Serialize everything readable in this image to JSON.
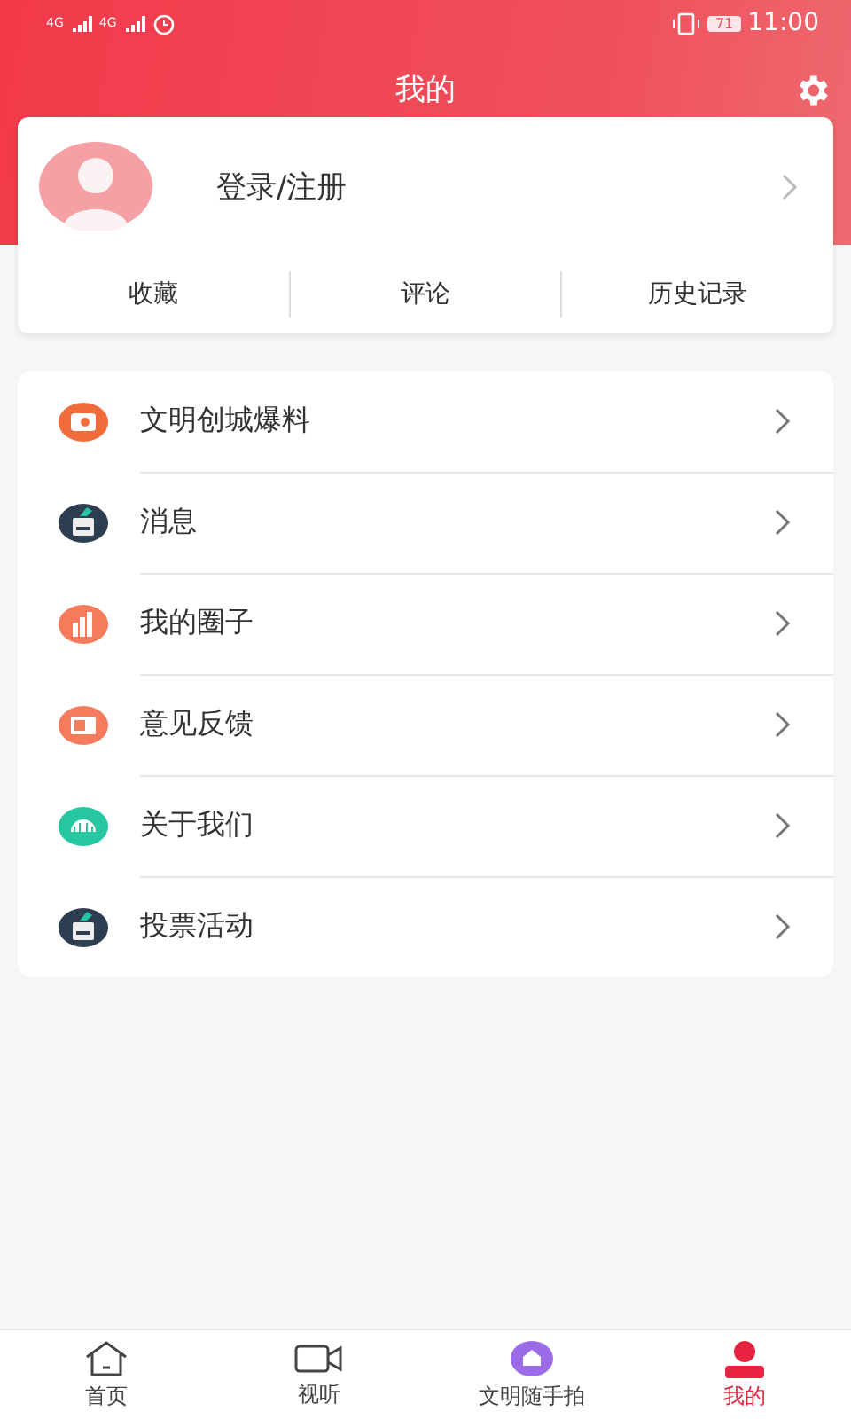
{
  "status_bar": {
    "network": [
      "4G",
      "4G"
    ],
    "battery": "71",
    "time": "11:00"
  },
  "header": {
    "title": "我的"
  },
  "profile": {
    "login": "登录/注册",
    "links": [
      "收藏",
      "评论",
      "历史记录"
    ]
  },
  "menu": [
    {
      "label": "文明创城爆料",
      "kind": "camera",
      "color": "#f26b3a"
    },
    {
      "label": "消息",
      "kind": "ballot",
      "color": "#2c3e50"
    },
    {
      "label": "我的圈子",
      "kind": "chart",
      "color": "#f47b5c"
    },
    {
      "label": "意见反馈",
      "kind": "screen",
      "color": "#f47b5c"
    },
    {
      "label": "关于我们",
      "kind": "globe",
      "color": "#26c6a0"
    },
    {
      "label": "投票活动",
      "kind": "ballot",
      "color": "#2c3e50"
    }
  ],
  "tab_bar": [
    {
      "label": "首页",
      "kind": "home",
      "selected": false
    },
    {
      "label": "视听",
      "kind": "video",
      "selected": false
    },
    {
      "label": "文明随手拍",
      "kind": "badge",
      "selected": false
    },
    {
      "label": "我的",
      "kind": "person",
      "selected": true
    }
  ]
}
